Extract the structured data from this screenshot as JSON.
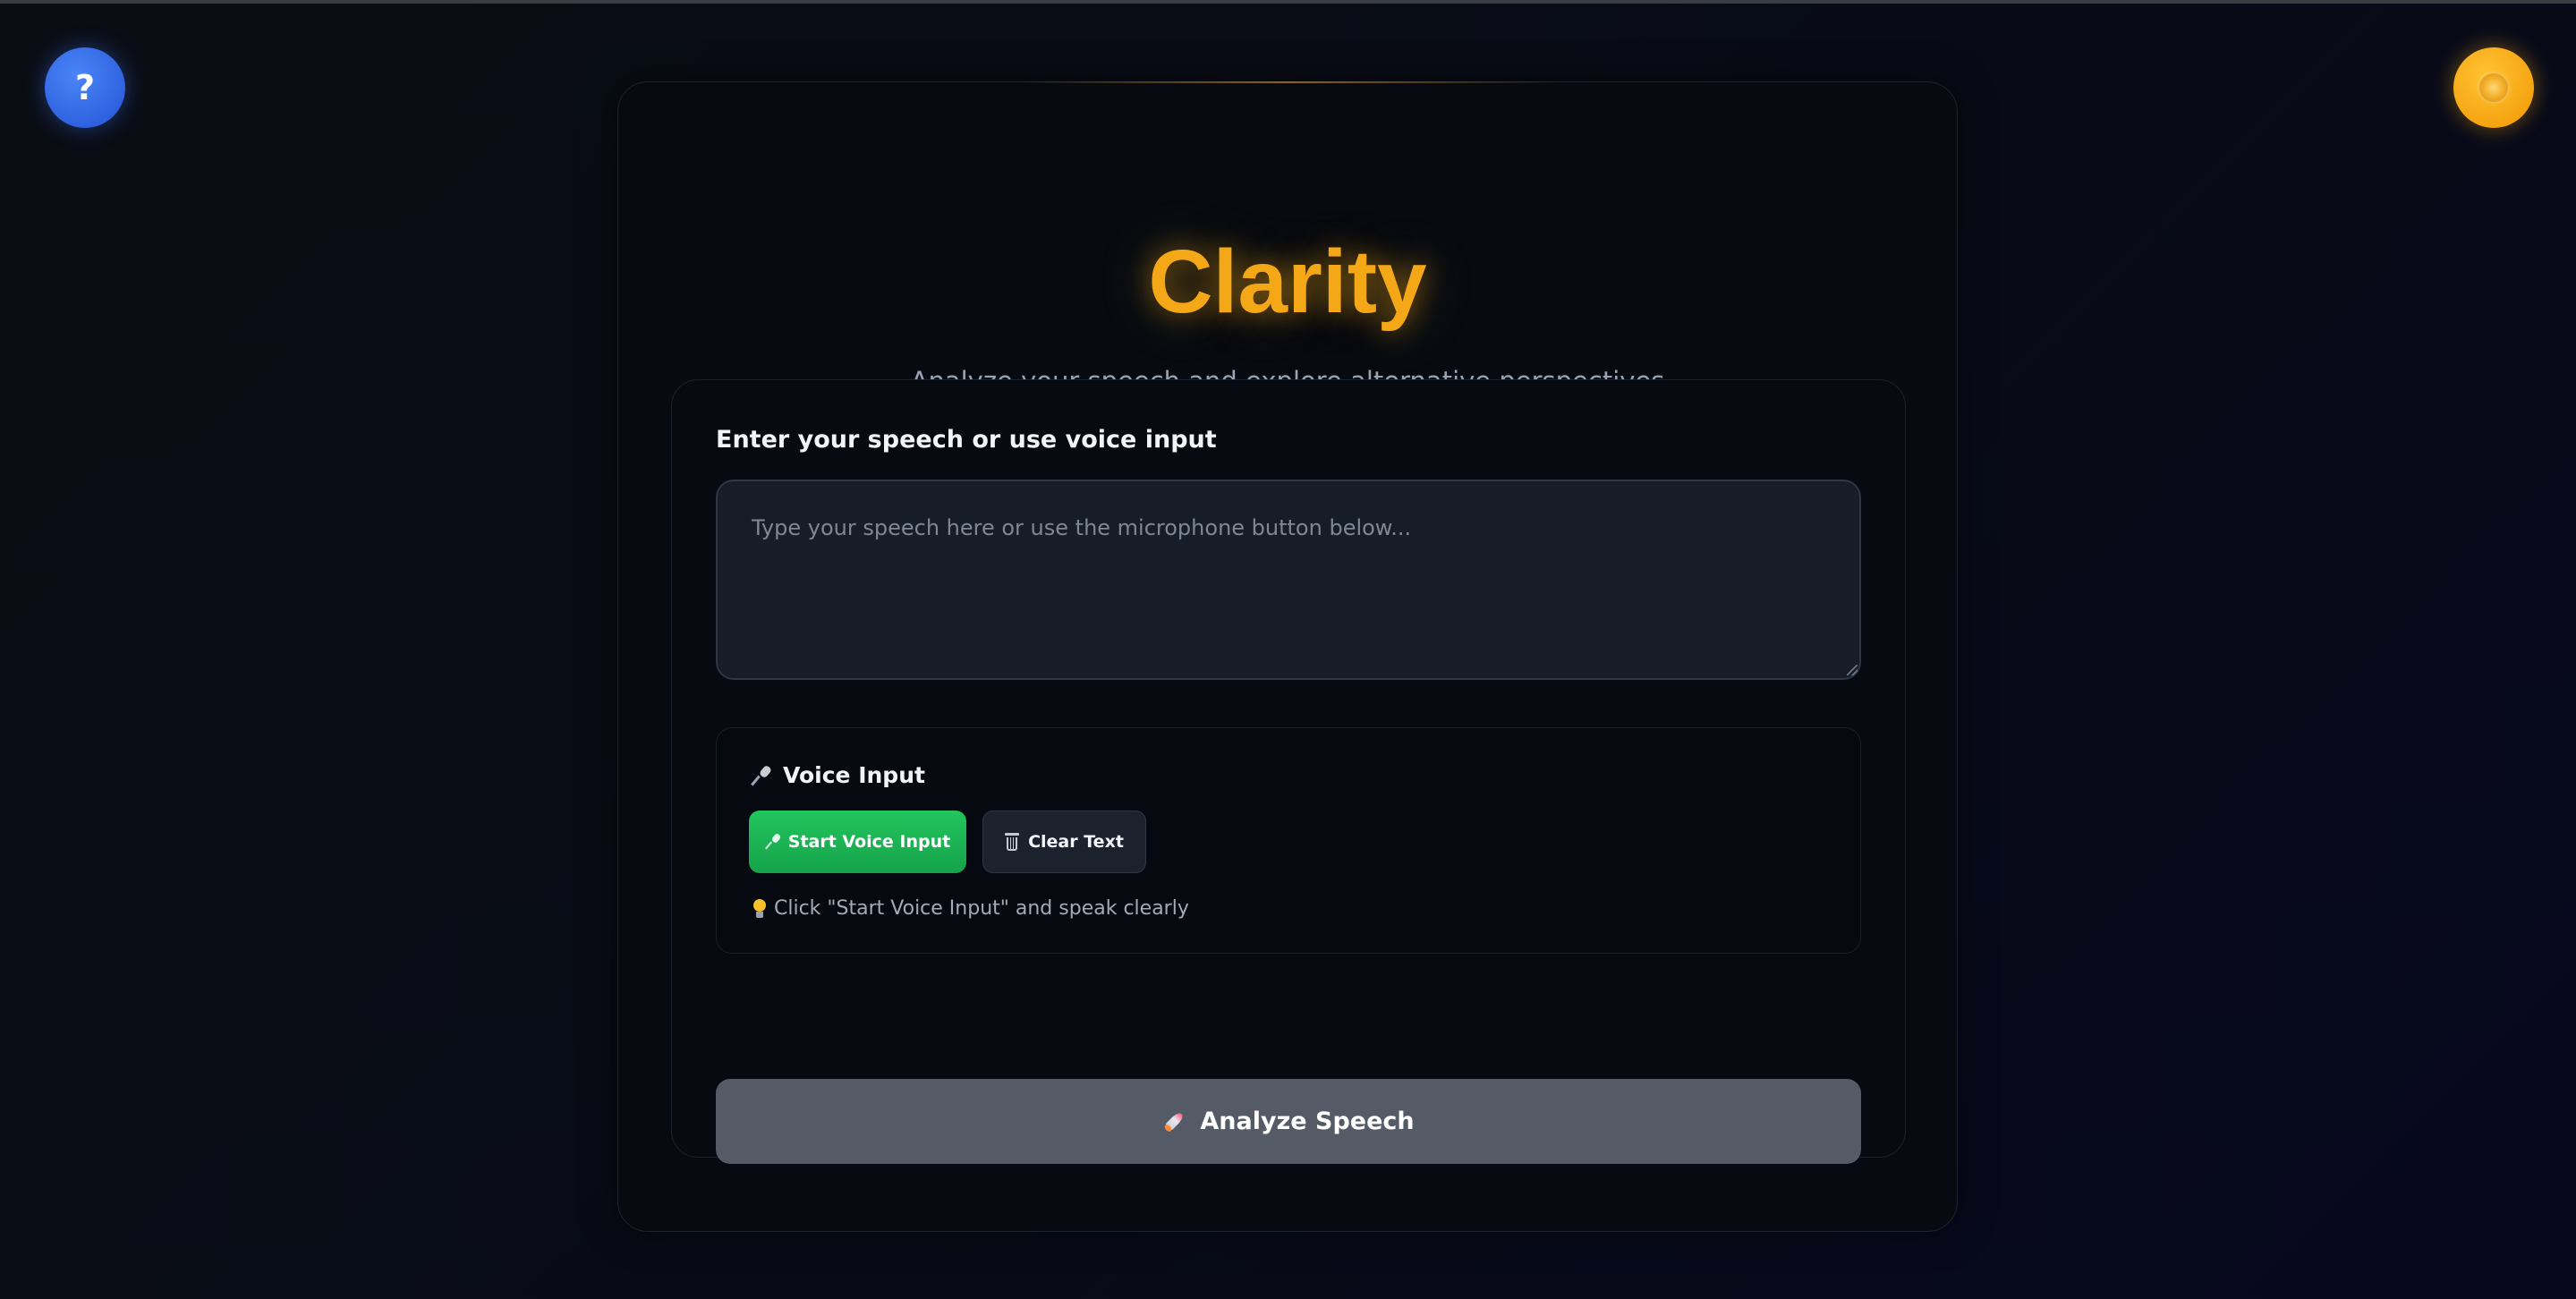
{
  "header": {
    "help_button_label": "?",
    "theme_toggle_icon": "sun-icon"
  },
  "hero": {
    "title": "Clarity",
    "subtitle": "Analyze your speech and explore alternative perspectives"
  },
  "form": {
    "input_label": "Enter your speech or use voice input",
    "speech_input": {
      "placeholder": "Type your speech here or use the microphone button below...",
      "value": ""
    },
    "voice": {
      "heading_icon": "microphone-icon",
      "heading": "Voice Input",
      "start_button_icon": "microphone-icon",
      "start_button_label": "Start Voice Input",
      "clear_button_icon": "trash-icon",
      "clear_button_label": "Clear Text",
      "hint_icon": "lightbulb-icon",
      "hint": "Click \"Start Voice Input\" and speak clearly"
    },
    "analyze_button_icon": "rocket-icon",
    "analyze_button_label": "Analyze Speech"
  },
  "colors": {
    "accent": "#f5a817",
    "help_button": "#2f62e0",
    "start_button": "#22c55e",
    "analyze_button": "#545a66",
    "background": "#0a0d14"
  }
}
